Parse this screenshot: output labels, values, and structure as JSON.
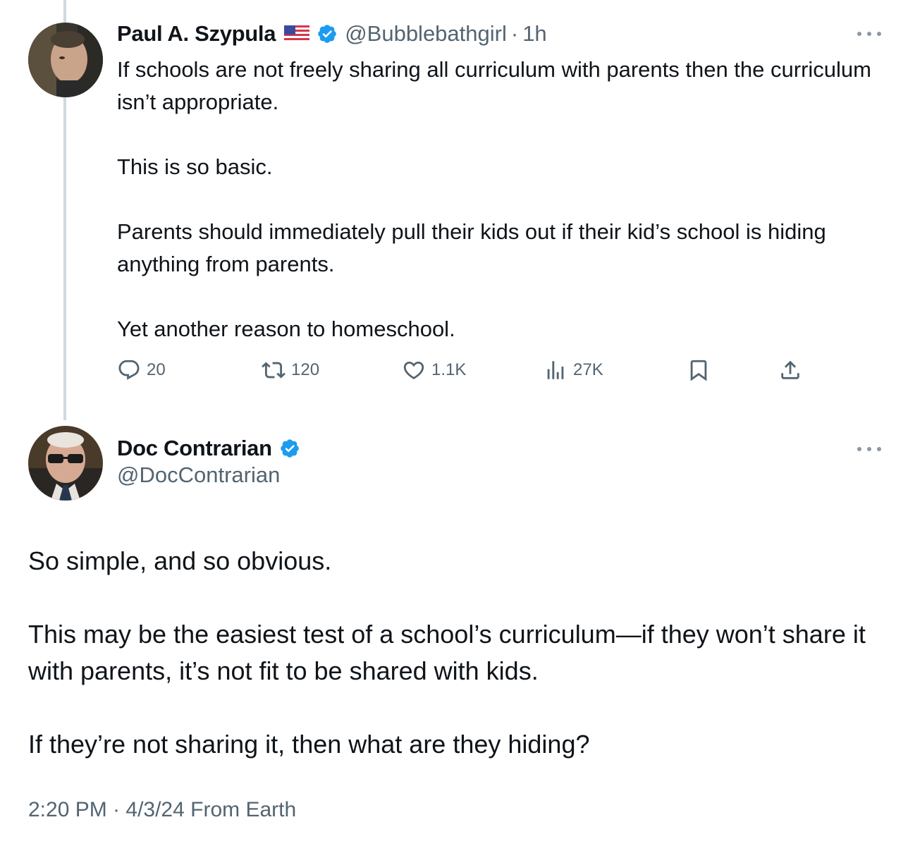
{
  "parent_tweet": {
    "author_name": "Paul A. Szypula",
    "handle": "@Bubblebathgirl",
    "separator": "·",
    "time": "1h",
    "paragraphs": [
      "If schools are not freely sharing all curriculum with parents then the curriculum isn’t appropriate.",
      "This is so basic.",
      "Parents should immediately pull their kids out if their kid’s school is hiding anything from parents.",
      "Yet another reason to homeschool."
    ],
    "actions": {
      "replies": "20",
      "reposts": "120",
      "likes": "1.1K",
      "views": "27K"
    },
    "icons": [
      "reply-icon",
      "retweet-icon",
      "heart-icon",
      "views-icon",
      "bookmark-icon",
      "share-icon",
      "more-icon",
      "verified-badge-icon",
      "us-flag-icon"
    ]
  },
  "main_tweet": {
    "author_name": "Doc Contrarian",
    "handle": "@DocContrarian",
    "paragraphs": [
      "So simple, and so obvious.",
      "This may be the easiest test of a school’s curriculum—if they won’t share it with parents, it’s not fit to be shared with kids.",
      "If they’re not sharing it, then what are they hiding?"
    ],
    "timestamp": "2:20 PM · 4/3/24 From Earth"
  },
  "colors": {
    "text": "#0f1419",
    "secondary": "#536471",
    "verified": "#1d9bf0",
    "thread_line": "#cfd9de"
  }
}
